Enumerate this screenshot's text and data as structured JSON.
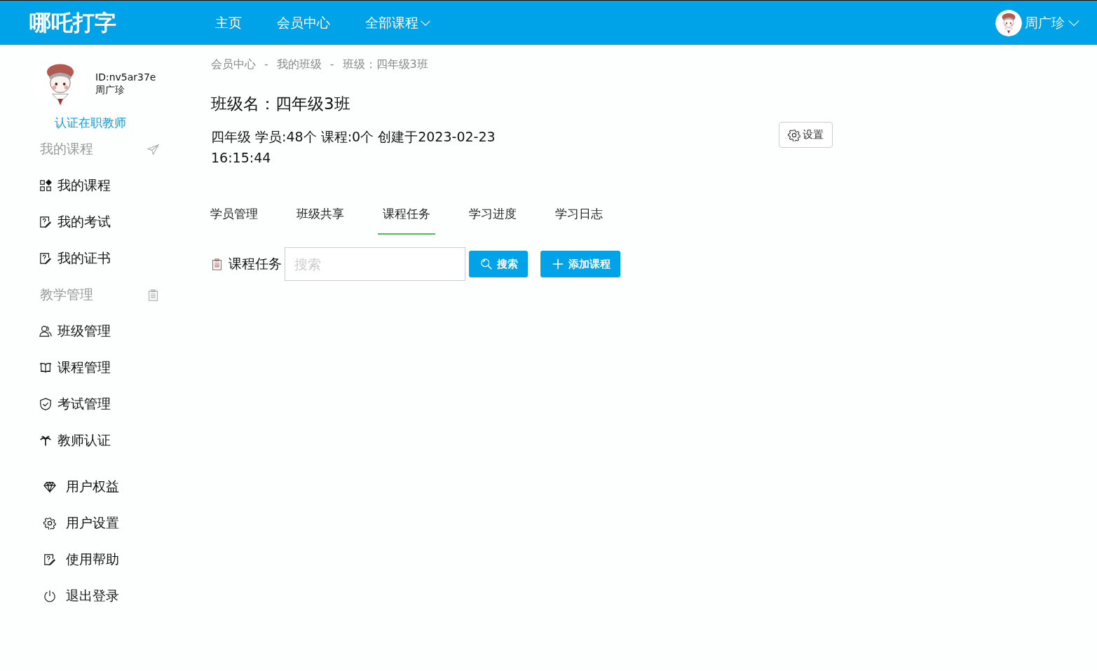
{
  "header": {
    "logo": "哪吒打字",
    "nav": [
      {
        "label": "主页",
        "dropdown": false
      },
      {
        "label": "会员中心",
        "dropdown": false
      },
      {
        "label": "全部课程",
        "dropdown": true
      }
    ],
    "user": {
      "name": "周广珍"
    }
  },
  "sidebar": {
    "profile": {
      "id": "ID:nv5ar37e",
      "name": "周广珍",
      "link": "认证在职教师"
    },
    "sections": [
      {
        "title": "我的课程",
        "items": [
          "我的课程",
          "我的考试",
          "我的证书"
        ]
      },
      {
        "title": "教学管理",
        "items": [
          "班级管理",
          "课程管理",
          "考试管理",
          "教师认证"
        ]
      }
    ],
    "account_items": [
      "用户权益",
      "用户设置",
      "使用帮助",
      "退出登录"
    ]
  },
  "breadcrumb": {
    "separator": "-",
    "items": [
      "会员中心",
      "我的班级",
      "班级：四年级3班"
    ]
  },
  "class_info": {
    "title": "班级名：四年级3班",
    "details": "四年级 学员:48个 课程:0个 创建于2023-02-23 16:15:44",
    "settings_button": "设置"
  },
  "tabs": [
    {
      "label": "学员管理",
      "selected": false
    },
    {
      "label": "班级共享",
      "selected": false
    },
    {
      "label": "课程任务",
      "selected": true
    },
    {
      "label": "学习进度",
      "selected": false
    },
    {
      "label": "学习日志",
      "selected": false
    }
  ],
  "task_bar": {
    "label": "课程任务",
    "search": {
      "placeholder": "搜索"
    },
    "search_button": "搜索",
    "add_button": "添加课程"
  }
}
